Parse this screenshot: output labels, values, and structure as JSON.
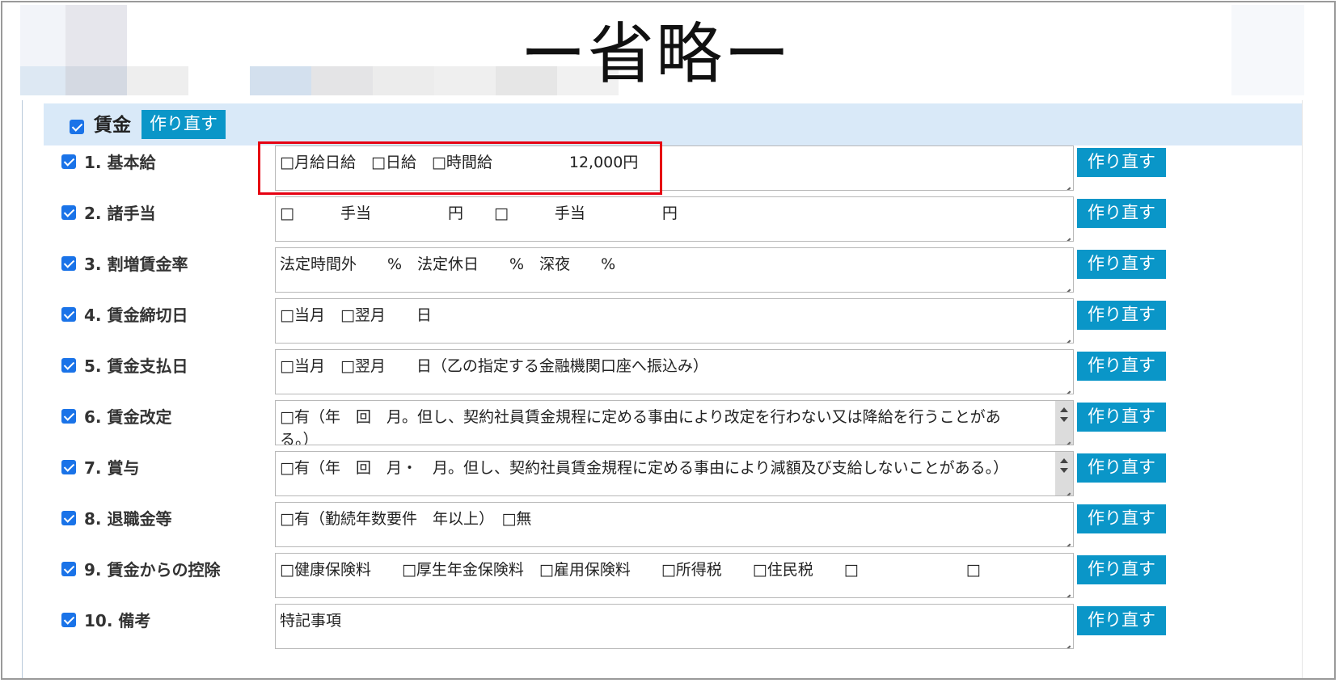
{
  "header": {
    "omitted_label": "ー省略ー"
  },
  "section": {
    "label": "賃金",
    "checked": true,
    "rebuild_label": "作り直す"
  },
  "rows": [
    {
      "label": "1. 基本給",
      "text": "□月給日給　□日給　□時間給　　　　　12,000円",
      "rebuild_label": "作り直す"
    },
    {
      "label": "2. 諸手当",
      "text": "□　　　手当　　　　　円　　□　　　手当　　　　　円",
      "rebuild_label": "作り直す"
    },
    {
      "label": "3. 割増賃金率",
      "text": "法定時間外　　%　法定休日　　%　深夜　　%",
      "rebuild_label": "作り直す"
    },
    {
      "label": "4. 賃金締切日",
      "text": "□当月　□翌月　　日",
      "rebuild_label": "作り直す"
    },
    {
      "label": "5. 賃金支払日",
      "text": "□当月　□翌月　　日（乙の指定する金融機関口座へ振込み）",
      "rebuild_label": "作り直す"
    },
    {
      "label": "6. 賃金改定",
      "text": "□有（年　回　月。但し、契約社員賃金規程に定める事由により改定を行わない又は降給を行うことがある。）",
      "rebuild_label": "作り直す"
    },
    {
      "label": "7. 賞与",
      "text": "□有（年　回　月・　月。但し、契約社員賃金規程に定める事由により減額及び支給しないことがある。）",
      "rebuild_label": "作り直す"
    },
    {
      "label": "8. 退職金等",
      "text": "□有（勤続年数要件　年以上）　□無",
      "rebuild_label": "作り直す"
    },
    {
      "label": "9. 賃金からの控除",
      "text": "□健康保険料　　□厚生年金保険料　□雇用保険料　　□所得税　　□住民税　　□　　　　　　　□",
      "rebuild_label": "作り直す"
    },
    {
      "label": "10. 備考",
      "text": "特記事項",
      "rebuild_label": "作り直す"
    }
  ],
  "colors": {
    "button": "#0a96c8",
    "section_bg": "#d9e9f8",
    "checkbox": "#1a73e8",
    "highlight": "#e60012"
  }
}
